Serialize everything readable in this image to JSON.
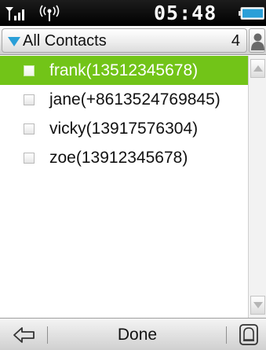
{
  "status_bar": {
    "time": "05:48",
    "icons": [
      "signal-strength-icon",
      "antenna-icon",
      "battery-icon"
    ]
  },
  "header": {
    "title": "All Contacts",
    "count": "4",
    "icons": [
      "dropdown-triangle-icon",
      "contact-person-icon"
    ]
  },
  "contacts": [
    {
      "label": "frank(13512345678)",
      "checked": false,
      "highlighted": true
    },
    {
      "label": "jane(+8613524769845)",
      "checked": false,
      "highlighted": false
    },
    {
      "label": "vicky(13917576304)",
      "checked": false,
      "highlighted": false
    },
    {
      "label": "zoe(13912345678)",
      "checked": false,
      "highlighted": false
    }
  ],
  "scrollbar": {
    "icons": [
      "scroll-up-arrow-icon",
      "scroll-down-arrow-icon"
    ]
  },
  "bottom_bar": {
    "done_label": "Done",
    "icons": [
      "back-arrow-icon",
      "options-menu-icon"
    ]
  },
  "colors": {
    "highlight": "#72c418",
    "accent_blue": "#2a9fd8",
    "status_bar": "#000000"
  }
}
